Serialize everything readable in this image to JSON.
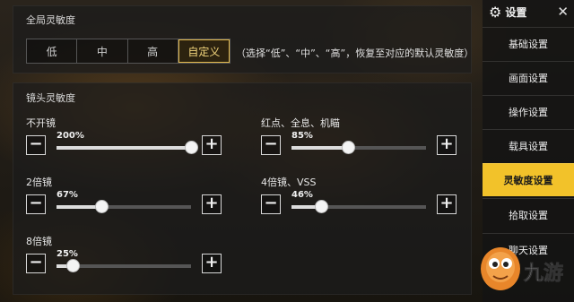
{
  "global": {
    "title": "全局灵敏度",
    "modes": [
      "低",
      "中",
      "高",
      "自定义"
    ],
    "active_mode": 3,
    "note": "（选择“低”、“中”、“高”，恢复至对应的默认灵敏度）"
  },
  "scope": {
    "title": "镜头灵敏度",
    "sliders": [
      {
        "label": "不开镜",
        "value": "200%",
        "fraction": 1.0
      },
      {
        "label": "红点、全息、机瞄",
        "value": "85%",
        "fraction": 0.42
      },
      {
        "label": "2倍镜",
        "value": "67%",
        "fraction": 0.33
      },
      {
        "label": "4倍镜、VSS",
        "value": "46%",
        "fraction": 0.22
      },
      {
        "label": "8倍镜",
        "value": "25%",
        "fraction": 0.12
      }
    ],
    "minus_glyph": "−",
    "plus_glyph": "+"
  },
  "sidebar": {
    "title": "设置",
    "gear_icon": "⚙",
    "close_icon": "✕",
    "items": [
      "基础设置",
      "画面设置",
      "操作设置",
      "载具设置",
      "灵敏度设置",
      "拾取设置",
      "聊天设置"
    ],
    "active_index": 4,
    "accent": "#f2c22a"
  },
  "watermark": {
    "text": "九游"
  }
}
